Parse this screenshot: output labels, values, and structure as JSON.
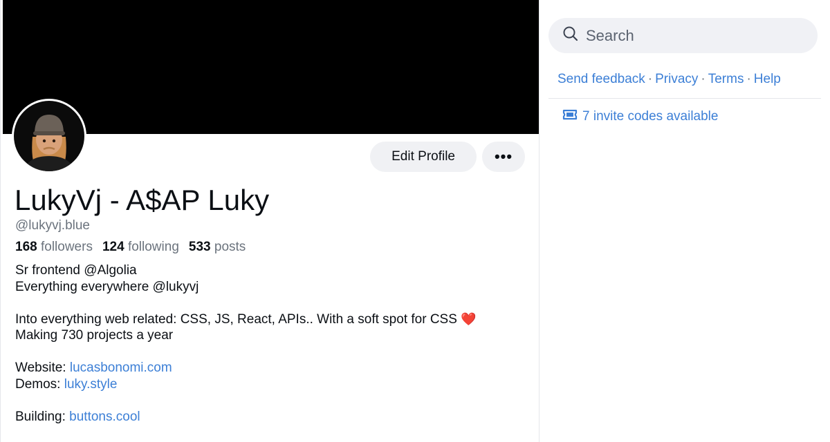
{
  "profile": {
    "display_name": "LukyVj - A$AP Luky",
    "handle": "@lukyvj.blue",
    "avatar_icon": "memoji-avatar"
  },
  "actions": {
    "edit_label": "Edit Profile",
    "more_label": "•••"
  },
  "stats": {
    "followers_count": "168",
    "followers_label": "followers",
    "following_count": "124",
    "following_label": "following",
    "posts_count": "533",
    "posts_label": "posts"
  },
  "bio": {
    "line1": "Sr frontend @Algolia",
    "line2": "Everything everywhere @lukyvj",
    "line3": "Into everything web related: CSS, JS, React, APIs.. With a soft spot for CSS",
    "heart": "❤️",
    "line4": "Making 730 projects a year",
    "website_label": "Website:",
    "website_link": "lucasbonomi.com",
    "demos_label": "Demos:",
    "demos_link": "luky.style",
    "building_label": "Building:",
    "building_link": "buttons.cool"
  },
  "sidebar": {
    "search_placeholder": "Search",
    "links": {
      "feedback": "Send feedback",
      "privacy": "Privacy",
      "terms": "Terms",
      "help": "Help",
      "separator": "·"
    },
    "invite_text": "7 invite codes available",
    "invite_icon": "ticket-icon"
  },
  "colors": {
    "accent": "#3c7fd6",
    "muted_text": "#6b737d",
    "button_bg": "#f0f1f4",
    "banner": "#000000",
    "heart": "#e0242b"
  }
}
